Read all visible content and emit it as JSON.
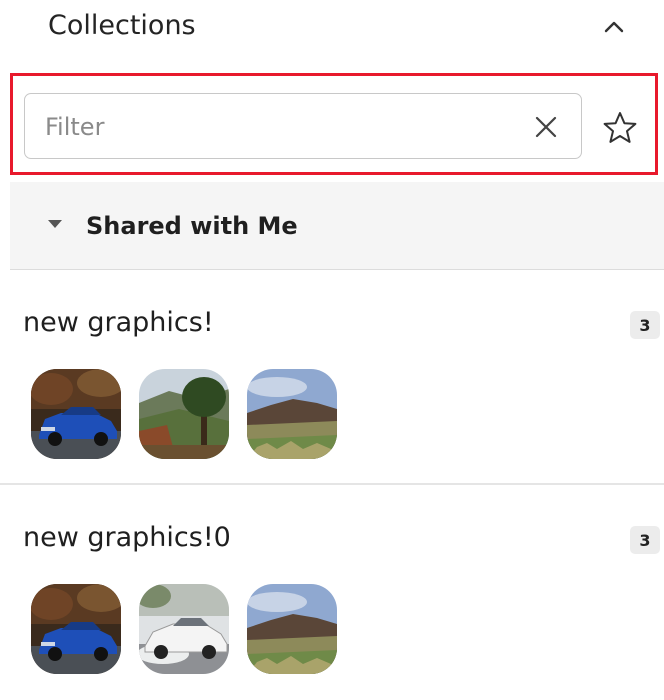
{
  "panel": {
    "title": "Collections"
  },
  "filter": {
    "value": "",
    "placeholder": "Filter"
  },
  "group": {
    "title": "Shared with Me"
  },
  "collections": [
    {
      "name": "new graphics!",
      "count": "3",
      "thumbnails": [
        "blue-car-image",
        "forest-landscape-image",
        "hills-landscape-image"
      ]
    },
    {
      "name": "new graphics!0",
      "count": "3",
      "thumbnails": [
        "blue-car-image",
        "white-car-image",
        "hills-landscape-image"
      ]
    }
  ],
  "icons": {
    "collapse": "chevron-up-icon",
    "clear": "close-icon",
    "favorite": "star-outline-icon",
    "group_toggle": "caret-down-icon"
  },
  "colors": {
    "highlight_border": "#e8192c",
    "group_header_bg": "#f5f5f5"
  }
}
